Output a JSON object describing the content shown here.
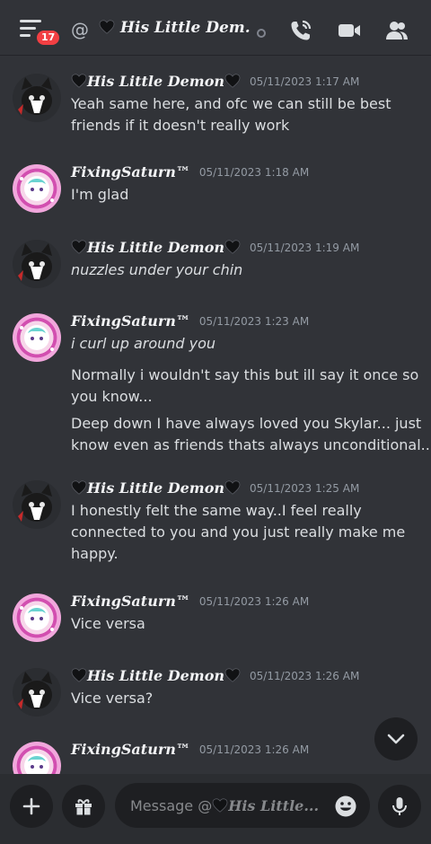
{
  "header": {
    "notification_count": "17",
    "at_symbol": "@",
    "channel_title": "His Little Dem...",
    "icons": [
      "hamburger-icon",
      "call-icon",
      "video-icon",
      "members-icon",
      "status-offline-icon"
    ]
  },
  "users": {
    "demon": "His Little Demon",
    "saturn": "FixingSaturn™"
  },
  "messages": [
    {
      "author": "demon",
      "time": "05/11/2023 1:17 AM",
      "lines": [
        "Yeah same here, and ofc we can still be best",
        "friends if it doesn't really work"
      ]
    },
    {
      "author": "saturn",
      "time": "05/11/2023 1:18 AM",
      "lines": [
        "I'm glad"
      ]
    },
    {
      "author": "demon",
      "time": "05/11/2023 1:19 AM",
      "lines": [
        "nuzzles under your chin"
      ]
    },
    {
      "author": "saturn",
      "time": "05/11/2023 1:23 AM",
      "lines": [
        "i curl up around you",
        "Normally i wouldn't say this but ill say it once so",
        "you know...",
        "Deep down I have always loved you Skylar... just",
        "know even as friends thats always unconditional..."
      ]
    },
    {
      "author": "demon",
      "time": "05/11/2023 1:25 AM",
      "lines": [
        "I honestly felt the same way..I feel really",
        "connected to you and you just really make me",
        "happy."
      ]
    },
    {
      "author": "saturn",
      "time": "05/11/2023 1:26 AM",
      "lines": [
        "Vice versa"
      ]
    },
    {
      "author": "demon",
      "time": "05/11/2023 1:26 AM",
      "lines": [
        "Vice versa?"
      ]
    },
    {
      "author": "saturn",
      "time": "05/11/2023 1:26 AM",
      "lines": []
    }
  ],
  "composer": {
    "placeholder_prefix": "Message @",
    "placeholder_name": "His Little...",
    "icons": [
      "plus-icon",
      "gift-icon",
      "emoji-icon",
      "microphone-icon",
      "chevron-down-icon"
    ]
  },
  "colors": {
    "background": "#313338",
    "composer_bg": "#2b2d31",
    "input_bg": "#1e1f22",
    "text": "#dbdee1",
    "muted": "#949ba4",
    "badge": "#f23f43"
  }
}
